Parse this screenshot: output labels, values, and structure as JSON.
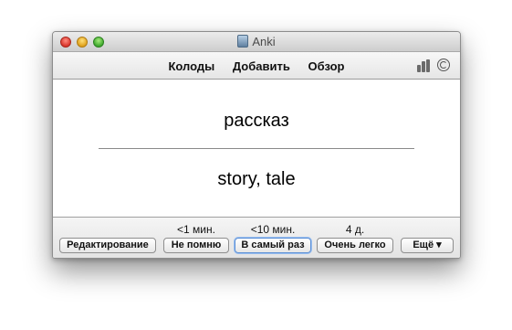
{
  "window": {
    "title": "Anki"
  },
  "toolbar": {
    "decks": "Колоды",
    "add": "Добавить",
    "browse": "Обзор"
  },
  "card": {
    "front": "рассказ",
    "back": "story, tale"
  },
  "answer": {
    "times": [
      "<1 мин.",
      "<10 мин.",
      "4 д."
    ],
    "edit_label": "Редактирование",
    "again_label": "Не помню",
    "good_label": "В самый раз",
    "easy_label": "Очень легко",
    "more_label": "Ещё ▾"
  },
  "colors": {
    "default_button_border": "#5b8fd6"
  }
}
